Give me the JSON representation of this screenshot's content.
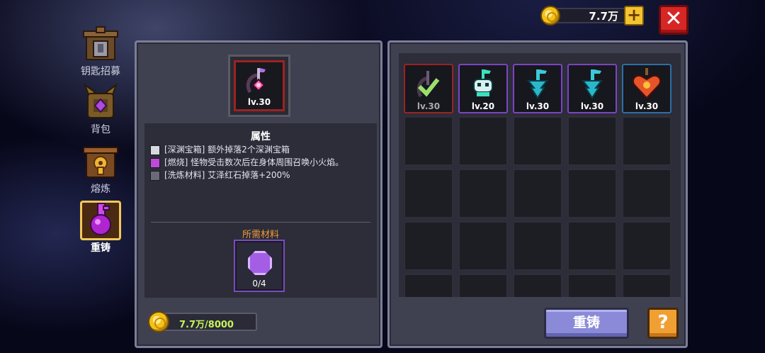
{
  "header": {
    "coins": "7.7万",
    "plus_label": "+",
    "close_label": "✕"
  },
  "nav": {
    "items": [
      {
        "label": "钥匙招募",
        "icon": "shrine-icon"
      },
      {
        "label": "背包",
        "icon": "backpack-icon"
      },
      {
        "label": "熔炼",
        "icon": "forge-icon"
      },
      {
        "label": "重铸",
        "icon": "reforge-key-icon",
        "active": true
      }
    ]
  },
  "detail": {
    "item_level": "lv.30",
    "attributes_title": "属性",
    "attributes": [
      {
        "text": "[深渊宝箱] 额外掉落2个深渊宝箱",
        "icon": "chest-icon"
      },
      {
        "text": "[燃烧] 怪物受击数次后在身体周围召唤小火焰。",
        "icon": "flame-icon"
      },
      {
        "text": "[洗炼材料] 艾泽红石掉落+200%",
        "icon": "gear-icon"
      }
    ],
    "materials_title": "所需材料",
    "material_count": "0/4",
    "gold_cost": "7.7万/8000"
  },
  "inventory": {
    "items": [
      {
        "level": "lv.30",
        "icon": "key-check-icon",
        "border": "#9b2323",
        "selected": true
      },
      {
        "level": "lv.20",
        "icon": "skull-key-icon",
        "border": "#7a45c4"
      },
      {
        "level": "lv.30",
        "icon": "teal-key-icon",
        "border": "#7a45c4"
      },
      {
        "level": "lv.30",
        "icon": "teal-key-icon",
        "border": "#7a45c4"
      },
      {
        "level": "lv.30",
        "icon": "heart-key-icon",
        "border": "#2d6fa3"
      }
    ]
  },
  "buttons": {
    "reforge": "重铸",
    "help": "?"
  },
  "colors": {
    "accent_gold": "#f4c430",
    "close_red": "#d72626",
    "material_title": "#f09a3e",
    "gold_text": "#c7f25d",
    "reforge_button": "#8a8ad8",
    "help_button": "#f0a033"
  }
}
